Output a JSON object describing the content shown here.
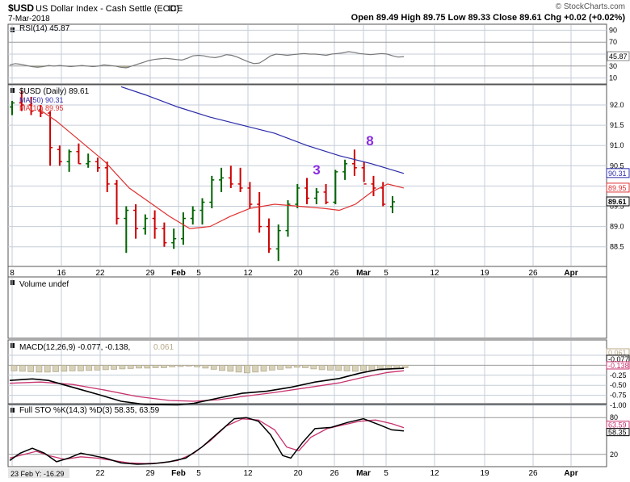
{
  "header": {
    "symbol": "$USD",
    "name": "US Dollar Index - Cash Settle (EOD)",
    "exchange": "ICE",
    "date": "7-Mar-2018",
    "watermark": "© StockCharts.com",
    "ohlc": "Open 89.49  High 89.75  Low 89.33  Close 89.61  Chg +0.02 (+0.02%)",
    "open": "89.49",
    "high": "89.75",
    "low": "89.33",
    "close": "89.61",
    "chg": "+0.02 (+0.02%)"
  },
  "panels": {
    "rsi": {
      "label": "RSI(14) 45.87",
      "value_tag": "45.87",
      "ticks": [
        "90",
        "70",
        "50",
        "30",
        "10"
      ]
    },
    "price": {
      "label": "$USD (Daily) 89.61",
      "ma50_label": "MA(50) 90.31",
      "ma10_label": "MA(10) 89.95",
      "ticks": [
        "92.0",
        "91.5",
        "91.0",
        "90.5",
        "90.0",
        "89.5",
        "89.0",
        "88.5"
      ],
      "tags": [
        "90.31",
        "89.95",
        "89.61"
      ],
      "annotations": [
        "3",
        "8"
      ]
    },
    "volume": {
      "label": "Volume undef"
    },
    "macd": {
      "label": "MACD(12,26,9) -0.077, -0.138, 0.061",
      "label_main": "MACD(12,26,9) -0.077, -0.138,",
      "label_hist": "0.061",
      "ticks": [
        "0.25",
        "0.00",
        "-0.25",
        "-0.50",
        "-0.75",
        "-1.00"
      ],
      "tags": [
        "0.061",
        "-0.077",
        "-0.138"
      ]
    },
    "sto": {
      "label": "Full STO %K(14,3) %D(3) 58.35, 63.59",
      "ticks": [
        "80",
        "20"
      ],
      "tags": [
        "63.59",
        "58.35"
      ]
    }
  },
  "xaxis": {
    "labels": [
      "8",
      "16",
      "22",
      "29",
      "Feb",
      "5",
      "12",
      "20",
      "26",
      "Mar",
      "5",
      "12",
      "19",
      "26",
      "Apr"
    ],
    "bottom_labels": [
      "22",
      "29",
      "Feb",
      "5",
      "12",
      "20",
      "26",
      "Mar",
      "5",
      "12",
      "19",
      "26",
      "Apr"
    ],
    "hover_readout": "23 Feb Y: -16.29"
  },
  "colors": {
    "up": "#006400",
    "down": "#cc0000",
    "ma50": "#2a2aa8",
    "ma10": "#e03030",
    "annotation": "#8a2be2",
    "rsi_line": "#777777",
    "macd_line": "#000000",
    "signal_line": "#c8326e",
    "hist": "#c8c1a8"
  },
  "chart_data": [
    {
      "type": "ohlc",
      "title": "$USD (Daily) 89.61",
      "dates": [
        "Jan 8",
        "Jan 9",
        "Jan 10",
        "Jan 11",
        "Jan 12",
        "Jan 16",
        "Jan 17",
        "Jan 18",
        "Jan 19",
        "Jan 22",
        "Jan 23",
        "Jan 24",
        "Jan 25",
        "Jan 26",
        "Jan 29",
        "Jan 30",
        "Jan 31",
        "Feb 1",
        "Feb 2",
        "Feb 5",
        "Feb 6",
        "Feb 7",
        "Feb 8",
        "Feb 9",
        "Feb 12",
        "Feb 13",
        "Feb 14",
        "Feb 15",
        "Feb 16",
        "Feb 20",
        "Feb 21",
        "Feb 22",
        "Feb 23",
        "Feb 26",
        "Feb 27",
        "Feb 28",
        "Mar 1",
        "Mar 2",
        "Mar 5",
        "Mar 6",
        "Mar 7"
      ],
      "ohlc": [
        [
          91.95,
          92.1,
          91.75,
          92.05
        ],
        [
          92.05,
          92.35,
          91.85,
          92.0
        ],
        [
          92.0,
          92.2,
          91.75,
          91.85
        ],
        [
          91.85,
          92.0,
          91.7,
          91.8
        ],
        [
          91.8,
          91.85,
          90.5,
          90.95
        ],
        [
          90.9,
          91.0,
          90.5,
          90.6
        ],
        [
          90.6,
          90.9,
          90.35,
          90.85
        ],
        [
          90.85,
          91.05,
          90.55,
          90.55
        ],
        [
          90.55,
          90.8,
          90.45,
          90.6
        ],
        [
          90.6,
          90.7,
          90.35,
          90.45
        ],
        [
          90.45,
          90.6,
          89.85,
          90.05
        ],
        [
          90.05,
          90.15,
          89.05,
          89.2
        ],
        [
          89.2,
          89.5,
          88.35,
          89.4
        ],
        [
          89.4,
          89.55,
          88.7,
          88.95
        ],
        [
          88.95,
          89.3,
          88.8,
          89.2
        ],
        [
          89.2,
          89.4,
          88.7,
          88.95
        ],
        [
          88.95,
          89.1,
          88.5,
          88.6
        ],
        [
          88.6,
          88.95,
          88.45,
          88.7
        ],
        [
          88.7,
          89.35,
          88.55,
          89.2
        ],
        [
          89.2,
          89.5,
          89.05,
          89.4
        ],
        [
          89.4,
          89.7,
          89.05,
          89.6
        ],
        [
          89.6,
          90.25,
          89.45,
          90.15
        ],
        [
          90.15,
          90.45,
          89.85,
          90.2
        ],
        [
          90.2,
          90.5,
          89.95,
          90.05
        ],
        [
          90.05,
          90.45,
          89.85,
          89.95
        ],
        [
          89.95,
          90.1,
          89.45,
          89.55
        ],
        [
          89.55,
          89.85,
          88.85,
          89.0
        ],
        [
          89.0,
          89.2,
          88.35,
          88.45
        ],
        [
          88.45,
          89.05,
          88.15,
          88.9
        ],
        [
          88.9,
          89.65,
          88.75,
          89.55
        ],
        [
          89.55,
          90.05,
          89.45,
          89.95
        ],
        [
          89.95,
          90.2,
          89.55,
          89.7
        ],
        [
          89.7,
          89.95,
          89.55,
          89.85
        ],
        [
          89.85,
          90.05,
          89.55,
          89.6
        ],
        [
          89.6,
          90.4,
          89.55,
          90.35
        ],
        [
          90.35,
          90.65,
          90.15,
          90.55
        ],
        [
          90.55,
          90.9,
          90.25,
          90.45
        ],
        [
          90.45,
          90.6,
          90.1,
          90.05
        ],
        [
          90.05,
          90.25,
          89.75,
          89.95
        ],
        [
          89.95,
          90.1,
          89.5,
          89.55
        ],
        [
          89.49,
          89.75,
          89.33,
          89.61
        ]
      ],
      "ma50": {
        "name": "MA(50)",
        "last": 90.31
      },
      "ma10": {
        "name": "MA(10)",
        "last": 89.95
      },
      "annotations": [
        {
          "text": "3",
          "date": "Feb 22"
        },
        {
          "text": "8",
          "date": "Mar 1"
        }
      ],
      "ylim": [
        88.2,
        92.4
      ]
    },
    {
      "type": "line",
      "title": "RSI(14) 45.87",
      "last": 45.87,
      "ylim": [
        0,
        100
      ]
    },
    {
      "type": "line",
      "title": "MACD(12,26,9)",
      "values": {
        "macd": -0.077,
        "signal": -0.138,
        "histogram": 0.061
      },
      "ylim": [
        -1.1,
        0.3
      ]
    },
    {
      "type": "line",
      "title": "Full STO %K(14,3) %D(3)",
      "values": {
        "k": 58.35,
        "d": 63.59
      },
      "ylim": [
        0,
        100
      ]
    }
  ]
}
